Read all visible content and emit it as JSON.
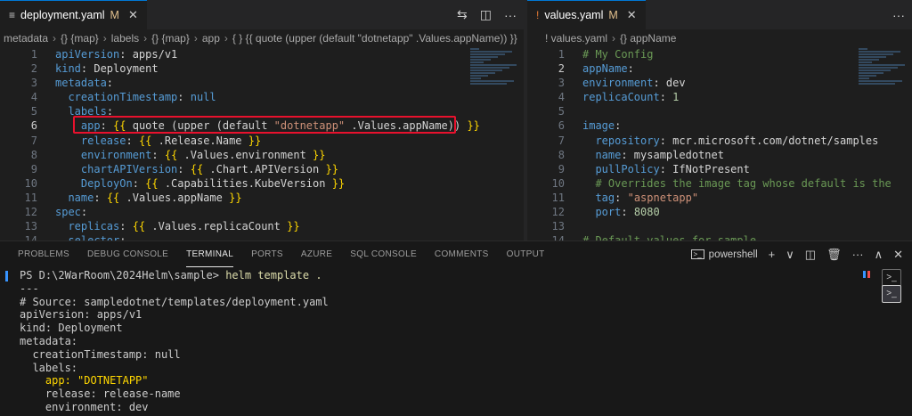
{
  "left_editor": {
    "tab": {
      "icon": "≡",
      "label": "deployment.yaml",
      "modified": "M",
      "close": "✕"
    },
    "actions": [
      "⇆",
      "◫",
      "···"
    ],
    "breadcrumb": [
      "metadata",
      "{} {map}",
      "labels",
      "{} {map}",
      "app",
      "{ } {{ quote (upper (default \"dotnetapp\" .Values.appName)) }}"
    ],
    "lines": [
      {
        "n": "1",
        "parts": [
          [
            "k",
            "apiVersion"
          ],
          [
            "t",
            ": apps/v1"
          ]
        ]
      },
      {
        "n": "2",
        "parts": [
          [
            "k",
            "kind"
          ],
          [
            "t",
            ": Deployment"
          ]
        ]
      },
      {
        "n": "3",
        "parts": [
          [
            "k",
            "metadata"
          ],
          [
            "t",
            ":"
          ]
        ]
      },
      {
        "n": "4",
        "parts": [
          [
            "t",
            "  "
          ],
          [
            "k",
            "creationTimestamp"
          ],
          [
            "t",
            ": "
          ],
          [
            "kw",
            "null"
          ]
        ]
      },
      {
        "n": "5",
        "parts": [
          [
            "t",
            "  "
          ],
          [
            "k",
            "labels"
          ],
          [
            "t",
            ":"
          ]
        ]
      },
      {
        "n": "6",
        "parts": [
          [
            "t",
            "    "
          ],
          [
            "k",
            "app"
          ],
          [
            "t",
            ": "
          ],
          [
            "br",
            "{{"
          ],
          [
            "t",
            " quote (upper (default "
          ],
          [
            "str",
            "\"dotnetapp\""
          ],
          [
            "t",
            " .Values.appName)) "
          ],
          [
            "br",
            "}}"
          ]
        ]
      },
      {
        "n": "7",
        "parts": [
          [
            "t",
            "    "
          ],
          [
            "k",
            "release"
          ],
          [
            "t",
            ": "
          ],
          [
            "br",
            "{{"
          ],
          [
            "t",
            " .Release.Name "
          ],
          [
            "br",
            "}}"
          ]
        ]
      },
      {
        "n": "8",
        "parts": [
          [
            "t",
            "    "
          ],
          [
            "k",
            "environment"
          ],
          [
            "t",
            ": "
          ],
          [
            "br",
            "{{"
          ],
          [
            "t",
            " .Values.environment "
          ],
          [
            "br",
            "}}"
          ]
        ]
      },
      {
        "n": "9",
        "parts": [
          [
            "t",
            "    "
          ],
          [
            "k",
            "chartAPIVersion"
          ],
          [
            "t",
            ": "
          ],
          [
            "br",
            "{{"
          ],
          [
            "t",
            " .Chart.APIVersion "
          ],
          [
            "br",
            "}}"
          ]
        ]
      },
      {
        "n": "10",
        "parts": [
          [
            "t",
            "    "
          ],
          [
            "k",
            "DeployOn"
          ],
          [
            "t",
            ": "
          ],
          [
            "br",
            "{{"
          ],
          [
            "t",
            " .Capabilities.KubeVersion "
          ],
          [
            "br",
            "}}"
          ]
        ]
      },
      {
        "n": "11",
        "parts": [
          [
            "t",
            "  "
          ],
          [
            "k",
            "name"
          ],
          [
            "t",
            ": "
          ],
          [
            "br",
            "{{"
          ],
          [
            "t",
            " .Values.appName "
          ],
          [
            "br",
            "}}"
          ]
        ]
      },
      {
        "n": "12",
        "parts": [
          [
            "k",
            "spec"
          ],
          [
            "t",
            ":"
          ]
        ]
      },
      {
        "n": "13",
        "parts": [
          [
            "t",
            "  "
          ],
          [
            "k",
            "replicas"
          ],
          [
            "t",
            ": "
          ],
          [
            "br",
            "{{"
          ],
          [
            "t",
            " .Values.replicaCount "
          ],
          [
            "br",
            "}}"
          ]
        ]
      },
      {
        "n": "14",
        "parts": [
          [
            "t",
            "  "
          ],
          [
            "k",
            "selector"
          ],
          [
            "t",
            ":"
          ]
        ]
      }
    ],
    "active_line": "6"
  },
  "right_editor": {
    "tab": {
      "icon": "!",
      "label": "values.yaml",
      "modified": "M",
      "close": "✕"
    },
    "actions": [
      "···"
    ],
    "breadcrumb": [
      "! values.yaml",
      "{} appName"
    ],
    "lines": [
      {
        "n": "1",
        "parts": [
          [
            "cm",
            "# My Config"
          ]
        ]
      },
      {
        "n": "2",
        "parts": [
          [
            "k",
            "appName"
          ],
          [
            "t",
            ":"
          ]
        ]
      },
      {
        "n": "3",
        "parts": [
          [
            "k",
            "environment"
          ],
          [
            "t",
            ": dev"
          ]
        ]
      },
      {
        "n": "4",
        "parts": [
          [
            "k",
            "replicaCount"
          ],
          [
            "t",
            ": "
          ],
          [
            "num",
            "1"
          ]
        ]
      },
      {
        "n": "5",
        "parts": []
      },
      {
        "n": "6",
        "parts": [
          [
            "k",
            "image"
          ],
          [
            "t",
            ":"
          ]
        ]
      },
      {
        "n": "7",
        "parts": [
          [
            "t",
            "  "
          ],
          [
            "k",
            "repository"
          ],
          [
            "t",
            ": mcr.microsoft.com/dotnet/samples"
          ]
        ]
      },
      {
        "n": "8",
        "parts": [
          [
            "t",
            "  "
          ],
          [
            "k",
            "name"
          ],
          [
            "t",
            ": mysampledotnet"
          ]
        ]
      },
      {
        "n": "9",
        "parts": [
          [
            "t",
            "  "
          ],
          [
            "k",
            "pullPolicy"
          ],
          [
            "t",
            ": IfNotPresent"
          ]
        ]
      },
      {
        "n": "10",
        "parts": [
          [
            "t",
            "  "
          ],
          [
            "cm",
            "# Overrides the image tag whose default is the"
          ]
        ]
      },
      {
        "n": "11",
        "parts": [
          [
            "t",
            "  "
          ],
          [
            "k",
            "tag"
          ],
          [
            "t",
            ": "
          ],
          [
            "str",
            "\"aspnetapp\""
          ]
        ]
      },
      {
        "n": "12",
        "parts": [
          [
            "t",
            "  "
          ],
          [
            "k",
            "port"
          ],
          [
            "t",
            ": "
          ],
          [
            "num",
            "8080"
          ]
        ]
      },
      {
        "n": "13",
        "parts": []
      },
      {
        "n": "14",
        "parts": [
          [
            "cm",
            "# Default values for sample"
          ]
        ]
      }
    ],
    "active_line": "2"
  },
  "panel": {
    "tabs": [
      "PROBLEMS",
      "DEBUG CONSOLE",
      "TERMINAL",
      "PORTS",
      "AZURE",
      "SQL CONSOLE",
      "COMMENTS",
      "OUTPUT"
    ],
    "active_tab": "TERMINAL",
    "shell_label": "powershell",
    "actions": [
      "+",
      "∨",
      "◫",
      "🗑",
      "···",
      "∧",
      "✕"
    ],
    "terminal": [
      {
        "p": "PS D:\\2WarRoom\\2024Helm\\sample> ",
        "c": "helm template ."
      },
      {
        "t": "---"
      },
      {
        "t": "# Source: sampledotnet/templates/deployment.yaml"
      },
      {
        "t": "apiVersion: apps/v1"
      },
      {
        "t": "kind: Deployment"
      },
      {
        "t": "metadata:"
      },
      {
        "t": "  creationTimestamp: null"
      },
      {
        "t": "  labels:"
      },
      {
        "k": "    app: \"DOTNETAPP\""
      },
      {
        "t": "    release: release-name"
      },
      {
        "t": "    environment: dev"
      }
    ]
  }
}
